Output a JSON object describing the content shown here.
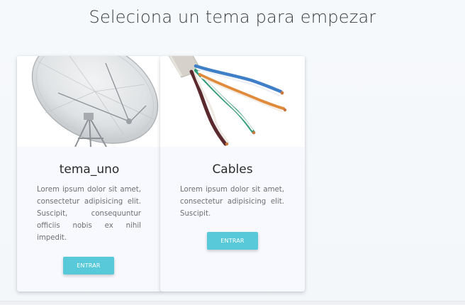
{
  "page": {
    "title": "Seleciona un tema para empezar"
  },
  "cards": [
    {
      "title": "tema_uno",
      "text": "Lorem ipsum dolor sit amet, consectetur adipisicing elit. Suscipit, consequuntur officiis nobis ex nihil impedit.",
      "button_label": "ENTRAR",
      "image": "satellite-dish-image"
    },
    {
      "title": "Cables",
      "text": "Lorem ipsum dolor sit amet, consectetur adipisicing elit. Suscipit.",
      "button_label": "ENTRAR",
      "image": "network-cable-image"
    }
  ],
  "colors": {
    "button": "#58c9d9",
    "card_background": "#f8f9fe"
  }
}
